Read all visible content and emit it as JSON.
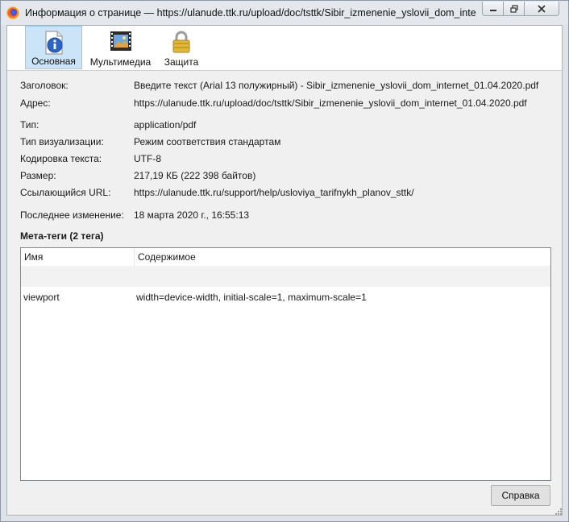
{
  "window": {
    "title": "Информация о странице — https://ulanude.ttk.ru/upload/doc/tsttk/Sibir_izmenenie_yslovii_dom_intern..."
  },
  "toolbar": {
    "tabs": [
      {
        "label": "Основная",
        "icon": "info-icon",
        "selected": true
      },
      {
        "label": "Мультимедиа",
        "icon": "multimedia-icon",
        "selected": false
      },
      {
        "label": "Защита",
        "icon": "lock-icon",
        "selected": false
      }
    ]
  },
  "general": {
    "title_label": "Заголовок:",
    "title_value": "Введите текст (Arial 13 полужирный) - Sibir_izmenenie_yslovii_dom_internet_01.04.2020.pdf",
    "address_label": "Адрес:",
    "address_value": "https://ulanude.ttk.ru/upload/doc/tsttk/Sibir_izmenenie_yslovii_dom_internet_01.04.2020.pdf",
    "type_label": "Тип:",
    "type_value": "application/pdf",
    "render_label": "Тип визуализации:",
    "render_value": "Режим соответствия стандартам",
    "encoding_label": "Кодировка текста:",
    "encoding_value": "UTF-8",
    "size_label": "Размер:",
    "size_value": "217,19 КБ (222 398 байтов)",
    "referrer_label": "Ссылающийся URL:",
    "referrer_value": "https://ulanude.ttk.ru/support/help/usloviya_tarifnykh_planov_sttk/",
    "modified_label": "Последнее изменение:",
    "modified_value": "18 марта 2020 г., 16:55:13"
  },
  "meta": {
    "heading": "Мета-теги (2 тега)",
    "columns": [
      "Имя",
      "Содержимое"
    ],
    "rows": [
      {
        "name": "viewport",
        "content": "width=device-width, initial-scale=1, maximum-scale=1"
      }
    ]
  },
  "buttons": {
    "help": "Справка"
  },
  "colors": {
    "selected_tab_bg": "#cce4f7",
    "selected_tab_border": "#99c9ef"
  }
}
